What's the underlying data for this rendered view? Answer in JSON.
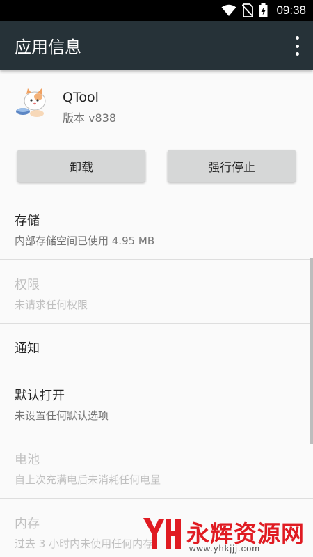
{
  "status_bar": {
    "time": "09:38",
    "icons": [
      "wifi-icon",
      "no-sim-icon",
      "battery-charging-icon"
    ]
  },
  "app_bar": {
    "title": "应用信息",
    "menu_icon": "more-vert-icon"
  },
  "app": {
    "name": "QTool",
    "version": "版本 v838",
    "icon": "cat-app-icon"
  },
  "buttons": {
    "uninstall": "卸载",
    "force_stop": "强行停止"
  },
  "settings": [
    {
      "title": "存储",
      "subtitle": "内部存储空间已使用 4.95 MB",
      "enabled": true
    },
    {
      "title": "权限",
      "subtitle": "未请求任何权限",
      "enabled": false
    },
    {
      "title": "通知",
      "subtitle": "",
      "enabled": true
    },
    {
      "title": "默认打开",
      "subtitle": "未设置任何默认选项",
      "enabled": true
    },
    {
      "title": "电池",
      "subtitle": "自上次充满电后未消耗任何电量",
      "enabled": false
    },
    {
      "title": "内存",
      "subtitle": "过去 3 小时内未使用任何内存",
      "enabled": false
    }
  ],
  "watermark": {
    "brand": "永辉资源网",
    "url": "www.yhkjjj.com"
  },
  "colors": {
    "app_bar": "#263238",
    "status_bar": "#000000",
    "watermark": "#e01b22"
  }
}
